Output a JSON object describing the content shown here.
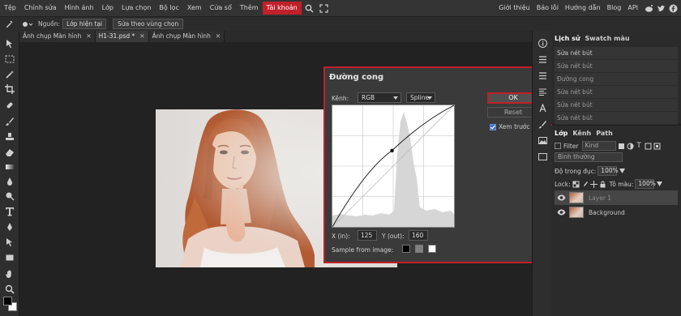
{
  "menubar": {
    "items": [
      {
        "label": "Tệp"
      },
      {
        "label": "Chỉnh sửa"
      },
      {
        "label": "Hình ảnh"
      },
      {
        "label": "Lớp"
      },
      {
        "label": "Lựa chọn"
      },
      {
        "label": "Bộ lọc"
      },
      {
        "label": "Xem"
      },
      {
        "label": "Cửa sổ"
      },
      {
        "label": "Thêm"
      },
      {
        "label": "Tài khoản"
      }
    ],
    "right_items": [
      {
        "label": "Giới thiệu"
      },
      {
        "label": "Báo lỗi"
      },
      {
        "label": "Hướng dẫn"
      },
      {
        "label": "Blog"
      },
      {
        "label": "API"
      }
    ]
  },
  "options_bar": {
    "source_label": "Nguồn:",
    "source_value": "Lớp hiện tại",
    "sample_button": "Sửa theo vùng chọn"
  },
  "tabs": [
    {
      "label": "Ảnh chụp Màn hình"
    },
    {
      "label": "H1-31.psd *"
    },
    {
      "label": "Ảnh chụp Màn hình"
    }
  ],
  "dialog": {
    "title": "Đường cong",
    "channel_label": "Kênh:",
    "channel_value": "RGB",
    "mode_value": "Spline",
    "x_label": "X (in):",
    "x_value": "125",
    "y_label": "Y (out):",
    "y_value": "160",
    "sample_label": "Sample from image:",
    "ok_label": "OK",
    "reset_label": "Reset",
    "preview_label": "Xem trước",
    "curve_point": {
      "in": 125,
      "out": 160
    }
  },
  "history_panel": {
    "tabs": [
      "Lịch sử",
      "Swatch màu"
    ],
    "items": [
      "Sửa nét bút",
      "Sửa nét bút",
      "Đường cong",
      "Sửa nét bút",
      "Sửa nét bút",
      "Sửa nét bút"
    ]
  },
  "layers_panel": {
    "tabs": [
      "Lớp",
      "Kênh",
      "Path"
    ],
    "filter_label": "Filter",
    "kind_value": "Kind",
    "blend_mode": "Bình thường",
    "opacity_label": "Độ trong đục:",
    "opacity_value": "100%",
    "lock_label": "Lock:",
    "fill_label": "Tô màu:",
    "fill_value": "100%",
    "layers": [
      {
        "name": "Layer 1"
      },
      {
        "name": "Background"
      }
    ]
  },
  "colors": {
    "accent": "#c0202a",
    "foreground": "#000000",
    "background": "#ffffff"
  }
}
